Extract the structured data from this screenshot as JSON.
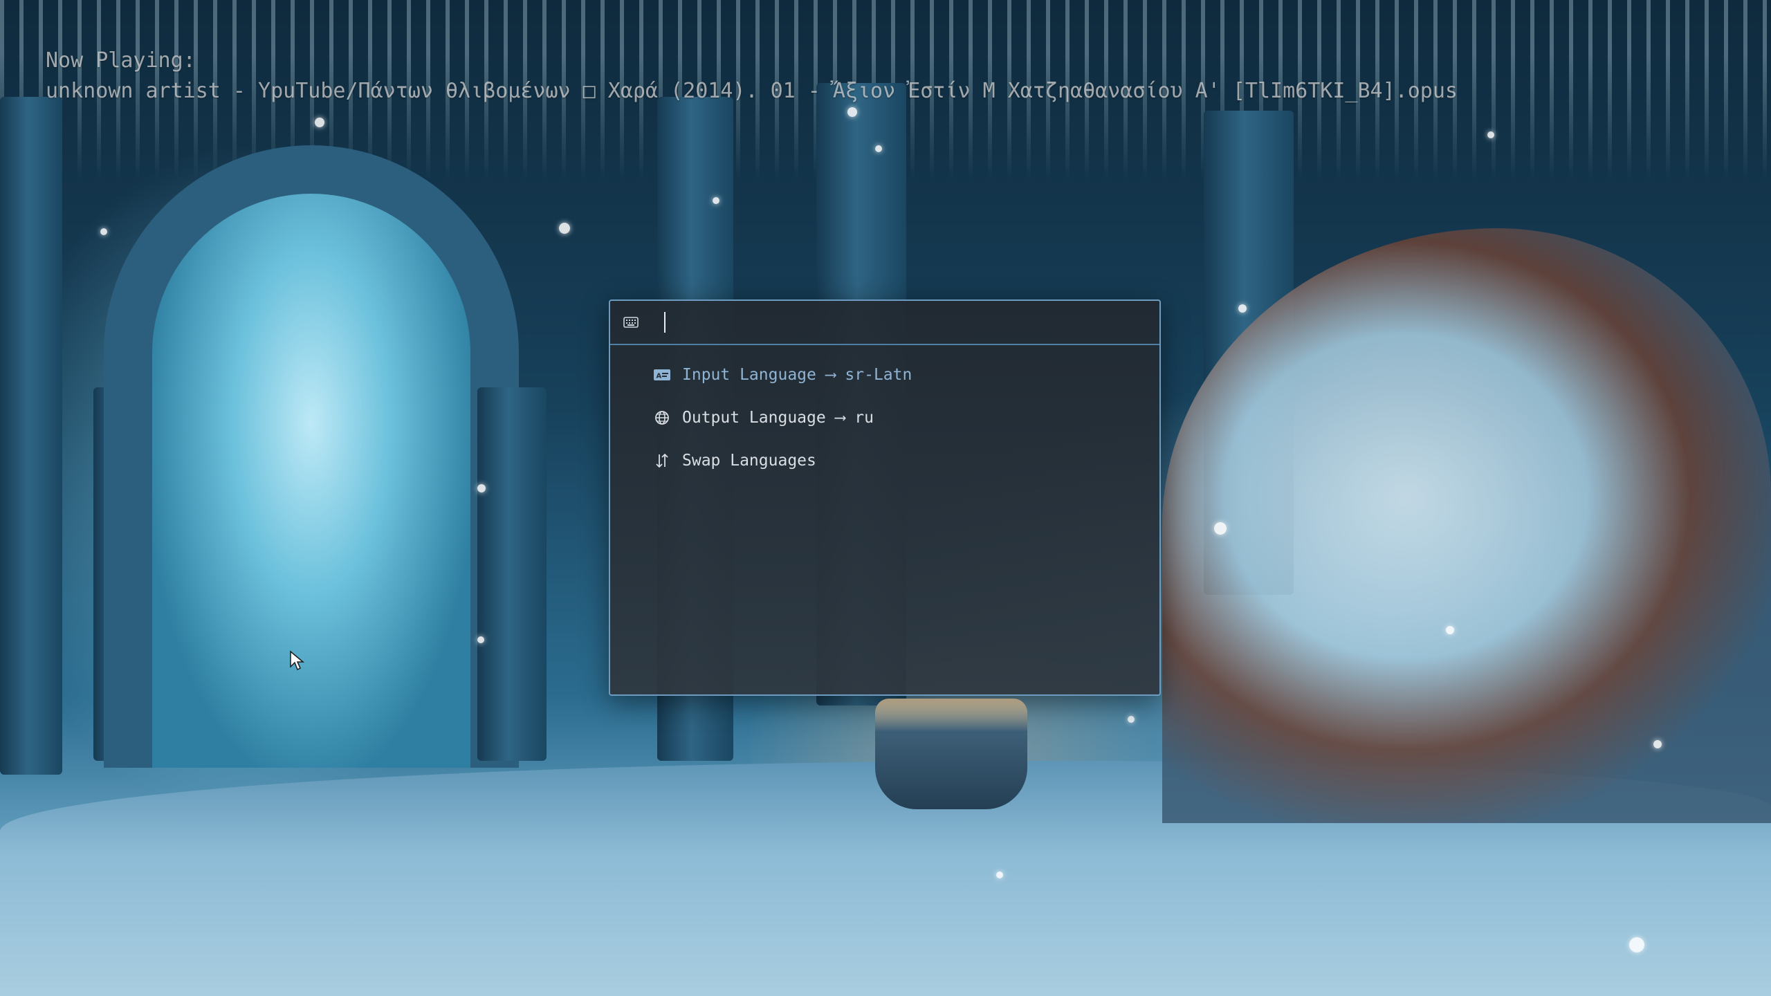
{
  "now_playing": {
    "label": "Now Playing:",
    "track": "unknown artist - YpuTube/Πάντων θλιβομένων □ Χαρά (2014). 01 - Ἄξιον Ἐστίν Μ Χατζηαθανασίου Α' [TlIm6TKI_B4].opus"
  },
  "launcher": {
    "search": {
      "value": "",
      "placeholder": "",
      "icon": "keyboard-icon"
    },
    "results": [
      {
        "icon": "language-card-icon",
        "label": "Input Language ⟶ sr-Latn",
        "selected": true
      },
      {
        "icon": "globe-icon",
        "label": "Output Language ⟶ ru",
        "selected": false
      },
      {
        "icon": "swap-vertical-icon",
        "label": "Swap Languages",
        "selected": false
      }
    ]
  },
  "colors": {
    "accent_border": "#6d9cc0",
    "selected_text": "#8fb4d4",
    "item_text": "#d9dee3",
    "window_bg": "#252c33"
  }
}
